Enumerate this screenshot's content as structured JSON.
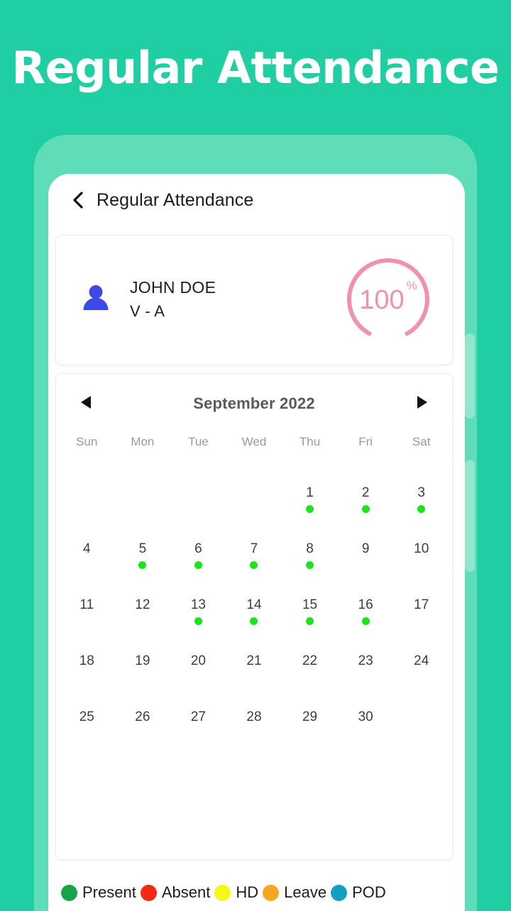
{
  "banner": {
    "title": "Regular Attendance"
  },
  "appbar": {
    "back_icon": "chevron-left-icon",
    "title": "Regular Attendance"
  },
  "profile": {
    "avatar_icon": "person-icon",
    "avatar_color": "#3b4ae3",
    "name": "JOHN DOE",
    "class": "V - A",
    "gauge": {
      "value": "100",
      "unit": "%",
      "percent": 100,
      "color": "#ef92ae"
    }
  },
  "calendar": {
    "prev_icon": "triangle-left-icon",
    "next_icon": "triangle-right-icon",
    "month_label": "September 2022",
    "weekdays": [
      "Sun",
      "Mon",
      "Tue",
      "Wed",
      "Thu",
      "Fri",
      "Sat"
    ],
    "leading_blanks": 4,
    "days": [
      {
        "num": "1",
        "status": "present"
      },
      {
        "num": "2",
        "status": "present"
      },
      {
        "num": "3",
        "status": "present"
      },
      {
        "num": "4",
        "status": ""
      },
      {
        "num": "5",
        "status": "present"
      },
      {
        "num": "6",
        "status": "present"
      },
      {
        "num": "7",
        "status": "present"
      },
      {
        "num": "8",
        "status": "present"
      },
      {
        "num": "9",
        "status": ""
      },
      {
        "num": "10",
        "status": ""
      },
      {
        "num": "11",
        "status": ""
      },
      {
        "num": "12",
        "status": ""
      },
      {
        "num": "13",
        "status": "present"
      },
      {
        "num": "14",
        "status": "present"
      },
      {
        "num": "15",
        "status": "present"
      },
      {
        "num": "16",
        "status": "present"
      },
      {
        "num": "17",
        "status": ""
      },
      {
        "num": "18",
        "status": ""
      },
      {
        "num": "19",
        "status": ""
      },
      {
        "num": "20",
        "status": ""
      },
      {
        "num": "21",
        "status": ""
      },
      {
        "num": "22",
        "status": ""
      },
      {
        "num": "23",
        "status": ""
      },
      {
        "num": "24",
        "status": ""
      },
      {
        "num": "25",
        "status": ""
      },
      {
        "num": "26",
        "status": ""
      },
      {
        "num": "27",
        "status": ""
      },
      {
        "num": "28",
        "status": ""
      },
      {
        "num": "29",
        "status": ""
      },
      {
        "num": "30",
        "status": ""
      }
    ],
    "dot_colors": {
      "present": "#1ce31c",
      "absent": "#f22a14",
      "hd": "#f7f718",
      "leave": "#f5a623",
      "pod": "#10a0c4"
    }
  },
  "legend": {
    "items": [
      {
        "label": "Present",
        "color": "#1aa34a"
      },
      {
        "label": "Absent",
        "color": "#f22a14"
      },
      {
        "label": "HD",
        "color": "#f7f718"
      },
      {
        "label": "Leave",
        "color": "#f5a623"
      },
      {
        "label": "POD",
        "color": "#10a0c4"
      }
    ]
  },
  "theme": {
    "background": "#1fcea2",
    "frame": "#5fdcb8",
    "frame_button": "#8ee8cd"
  }
}
